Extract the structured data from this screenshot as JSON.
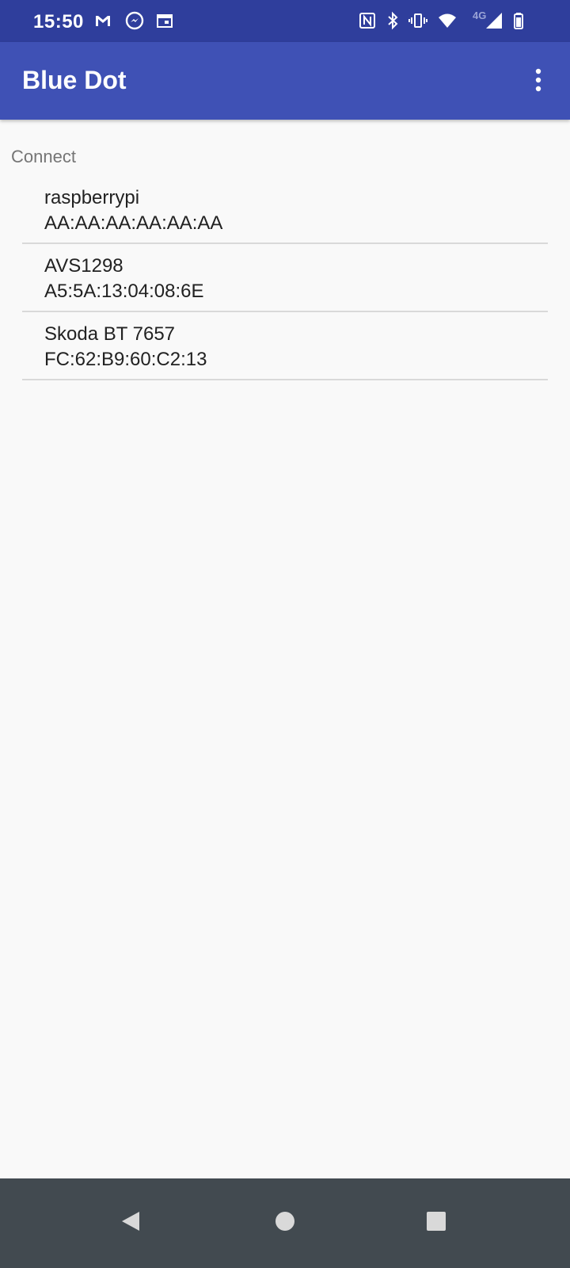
{
  "status_bar": {
    "time": "15:50",
    "network": "4G",
    "icons": [
      "gmail-icon",
      "messenger-icon",
      "calendar-icon",
      "nfc-icon",
      "bluetooth-icon",
      "vibrate-icon",
      "wifi-icon",
      "signal-icon",
      "battery-icon"
    ]
  },
  "app_bar": {
    "title": "Blue Dot",
    "overflow_icon": "more-vert-icon"
  },
  "section": {
    "header": "Connect"
  },
  "devices": [
    {
      "name": "raspberrypi",
      "address": "AA:AA:AA:AA:AA:AA"
    },
    {
      "name": "AVS1298",
      "address": "A5:5A:13:04:08:6E"
    },
    {
      "name": "Skoda BT 7657",
      "address": "FC:62:B9:60:C2:13"
    }
  ],
  "nav_bar": {
    "icons": [
      "back-icon",
      "home-icon",
      "recents-icon"
    ]
  },
  "colors": {
    "status_bar": "#2f3e9c",
    "app_bar": "#3f51b5",
    "background": "#f9f9f9",
    "nav_bar": "#424a50"
  }
}
